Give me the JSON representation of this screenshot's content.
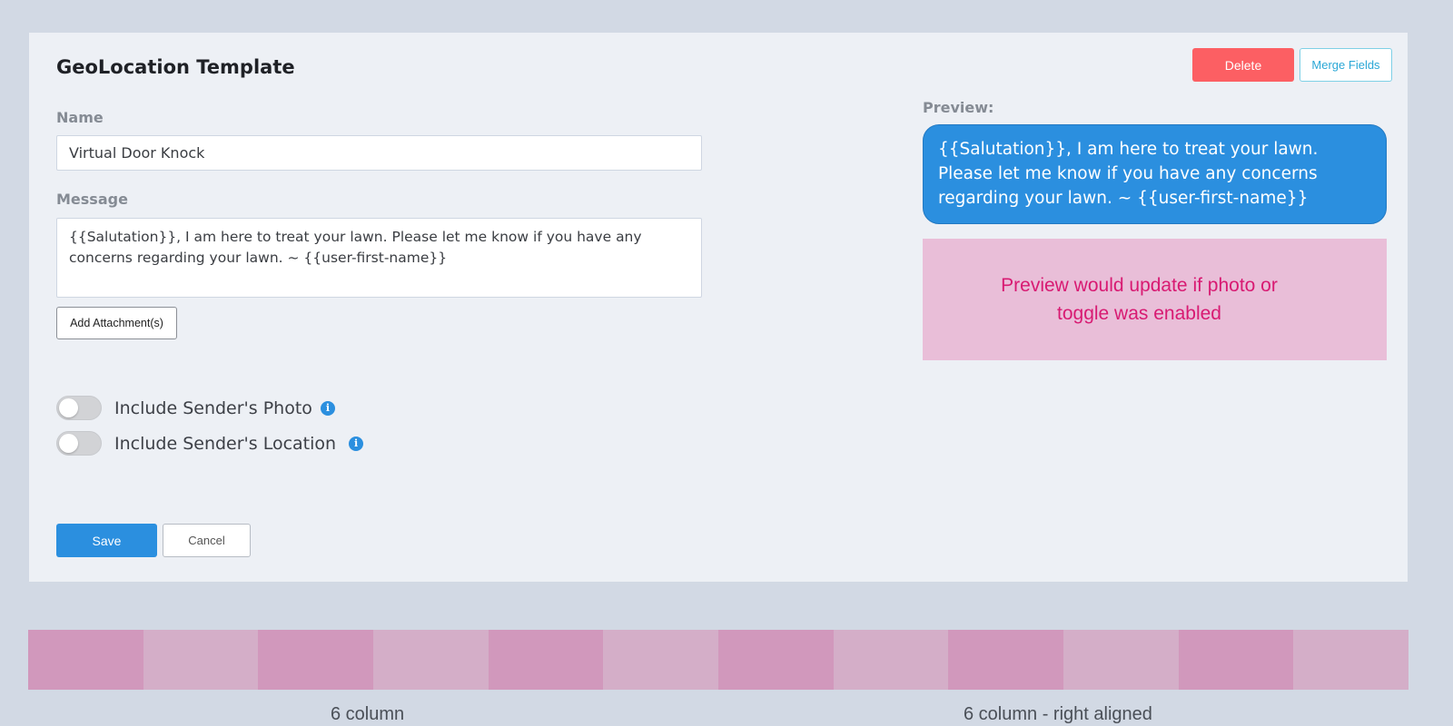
{
  "template": {
    "title": "GeoLocation Template",
    "delete_label": "Delete",
    "merge_fields_label": "Merge Fields",
    "name_label": "Name",
    "name_value": "Virtual Door Knock",
    "message_label": "Message",
    "message_value": "{{Salutation}}, I am here to treat your lawn. Please let me know if you have any concerns regarding your lawn. ~ {{user-first-name}}",
    "add_attachment_label": "Add Attachment(s)",
    "toggles": [
      {
        "label": "Include Sender's Photo",
        "enabled": false,
        "icon": "info-icon"
      },
      {
        "label": "Include Sender's Location",
        "enabled": false,
        "icon": "info-icon"
      }
    ],
    "save_label": "Save",
    "cancel_label": "Cancel"
  },
  "preview": {
    "label": "Preview:",
    "bubble_text": "{{Salutation}}, I am here to treat your lawn. Please let me know if you have any concerns regarding your lawn. ~ {{user-first-name}}",
    "note": "Preview would update if photo or toggle was enabled"
  },
  "grid_overlay": {
    "columns": 12,
    "left_caption": "6 column",
    "right_caption": "6 column - right aligned"
  },
  "colors": {
    "primary": "#2b8fdf",
    "danger": "#fc5f63",
    "note_text": "#d81a72",
    "note_bg": "#e9bed8"
  }
}
